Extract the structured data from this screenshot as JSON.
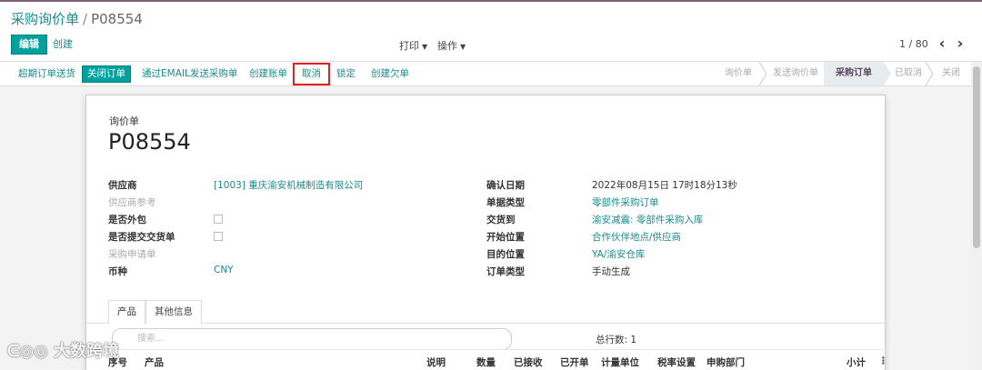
{
  "breadcrumb": {
    "parent": "采购询价单",
    "current": "P08554"
  },
  "control_panel": {
    "edit_label": "编辑",
    "create_label": "创建",
    "print_label": "打印",
    "action_label": "操作",
    "pager": "1 / 80"
  },
  "statusbar": {
    "buttons": [
      "超期订单送货",
      "关闭订单",
      "通过EMAIL发送采购单",
      "创建账单",
      "取消",
      "锁定",
      "创建欠单"
    ],
    "stages": [
      "询价单",
      "发送询价单",
      "采购订单",
      "已取消",
      "关闭"
    ],
    "active_stage": "采购订单"
  },
  "sheet": {
    "kind": "询价单",
    "name": "P08554",
    "left_fields": [
      {
        "label": "供应商",
        "value": "[1003] 重庆渝安机械制造有限公司"
      },
      {
        "label": "供应商参考",
        "value": ""
      },
      {
        "label": "是否外包",
        "value": ""
      },
      {
        "label": "是否提交交货单",
        "value": ""
      },
      {
        "label": "采购申请单",
        "value": ""
      },
      {
        "label": "币种",
        "value": "CNY"
      }
    ],
    "right_fields": [
      {
        "label": "确认日期",
        "value": "2022年08月15日 17时18分13秒"
      },
      {
        "label": "单据类型",
        "value": "零部件采购订单"
      },
      {
        "label": "交货到",
        "value": "渝安减震: 零部件采购入库"
      },
      {
        "label": "开始位置",
        "value": "合作伙伴地点/供应商"
      },
      {
        "label": "目的位置",
        "value": "YA/渝安仓库"
      },
      {
        "label": "订单类型",
        "value": "手动生成"
      }
    ],
    "tabs": [
      "产品",
      "其他信息"
    ],
    "search_placeholder": "搜索...",
    "total_rows": "总行数: 1",
    "columns": [
      "序号",
      "产品",
      "说明",
      "数量",
      "已接收",
      "已开单",
      "计量单位",
      "税率设置",
      "申购部门",
      "小计"
    ]
  },
  "watermark": "大数跨境"
}
